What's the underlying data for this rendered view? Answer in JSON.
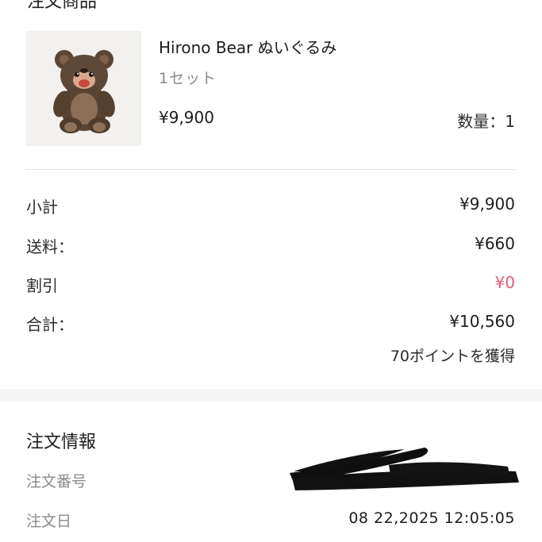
{
  "section_top": {
    "title": "注文商品"
  },
  "product": {
    "name": "Hirono Bear ぬいぐるみ",
    "variant": "1セット",
    "price": "¥9,900",
    "quantity": "数量：1"
  },
  "summary": {
    "subtotal": {
      "label": "小計",
      "value": "¥9,900"
    },
    "shipping": {
      "label": "送料：",
      "value": "¥660"
    },
    "discount": {
      "label": "割引",
      "value": "¥0",
      "color": "#e36078"
    },
    "total": {
      "label": "合計：",
      "value": "¥10,560"
    },
    "points": "70ポイントを獲得"
  },
  "order_info": {
    "title": "注文情報",
    "order_number": {
      "label": "注文番号",
      "value": ""
    },
    "order_date": {
      "label": "注文日",
      "value": "08 22,2025 12:05:05"
    }
  }
}
